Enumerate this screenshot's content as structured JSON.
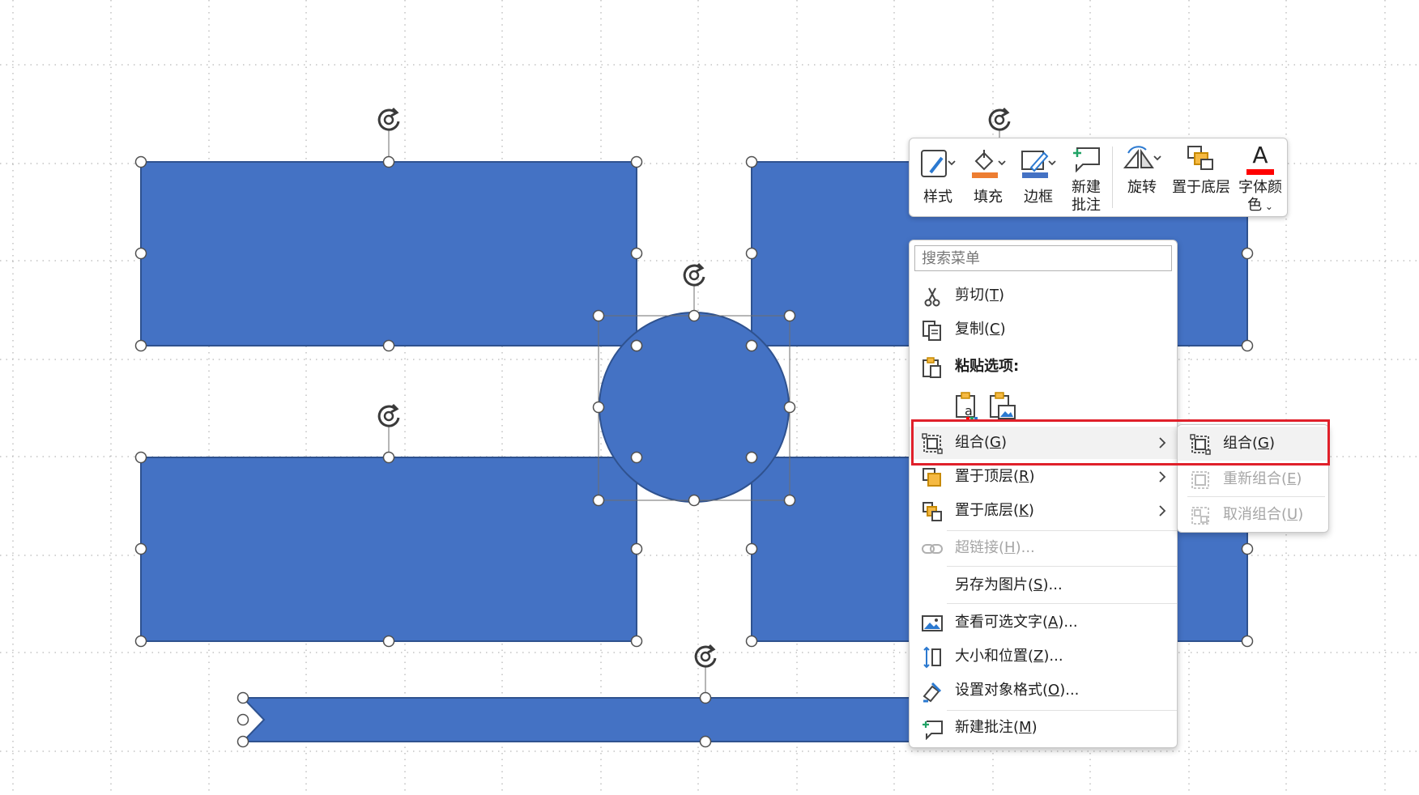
{
  "colors": {
    "shape_fill": "#4472c4",
    "shape_stroke": "#2f528f",
    "highlight": "#e0202a",
    "disabled_text": "#a6a6a6"
  },
  "mini_toolbar": {
    "style": "样式",
    "fill": "填充",
    "outline": "边框",
    "new_comment_line1": "新建",
    "new_comment_line2": "批注",
    "rotate": "旋转",
    "send_to_back": "置于底层",
    "font_color_line1": "字体颜",
    "font_color_line2": "色",
    "font_color_glyph": "A"
  },
  "context_menu": {
    "search_placeholder": "搜索菜单",
    "items": {
      "cut": {
        "label": "剪切",
        "key": "T"
      },
      "copy": {
        "label": "复制",
        "key": "C"
      },
      "paste_options": {
        "label": "粘贴选项:"
      },
      "group": {
        "label": "组合",
        "key": "G"
      },
      "bring_to_front": {
        "label": "置于顶层",
        "key": "R"
      },
      "send_to_back": {
        "label": "置于底层",
        "key": "K"
      },
      "hyperlink": {
        "label": "超链接",
        "key": "H",
        "suffix": "..."
      },
      "save_as_picture": {
        "label": "另存为图片",
        "key": "S",
        "suffix": "..."
      },
      "alt_text": {
        "label": "查看可选文字",
        "key": "A",
        "suffix": "..."
      },
      "size_position": {
        "label": "大小和位置",
        "key": "Z",
        "suffix": "..."
      },
      "format_object": {
        "label": "设置对象格式",
        "key": "O",
        "suffix": "..."
      },
      "new_comment": {
        "label": "新建批注",
        "key": "M"
      }
    }
  },
  "submenu": {
    "group": {
      "label": "组合",
      "key": "G"
    },
    "regroup": {
      "label": "重新组合",
      "key": "E"
    },
    "ungroup": {
      "label": "取消组合",
      "key": "U"
    }
  }
}
